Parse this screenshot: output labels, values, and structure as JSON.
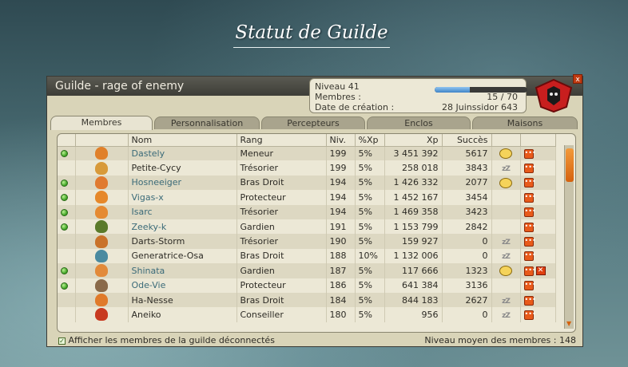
{
  "page_title": "Statut de Guilde",
  "window": {
    "title": "Guilde - rage of enemy",
    "close_label": "x",
    "info": {
      "level_label": "Niveau 41",
      "members_label": "Membres :",
      "members_value": "15 / 70",
      "creation_label": "Date de création :",
      "creation_value": "28 Juinssidor 643",
      "xp_progress": 0.38
    },
    "tabs": [
      "Membres",
      "Personnalisation",
      "Percepteurs",
      "Enclos",
      "Maisons"
    ],
    "active_tab": 0,
    "columns": [
      "Nom",
      "Rang",
      "Niv.",
      "%Xp",
      "Xp",
      "Succès"
    ],
    "members": [
      {
        "online": true,
        "name": "Dastely",
        "rank": "Meneur",
        "level": "199",
        "xp_pct": "5%",
        "xp": "3 451 392",
        "success": "5617",
        "status_icon": "emote"
      },
      {
        "online": false,
        "name": "Petite-Cycy",
        "rank": "Trésorier",
        "level": "199",
        "xp_pct": "5%",
        "xp": "258 018",
        "success": "3843",
        "status_icon": "sleep"
      },
      {
        "online": true,
        "name": "Hosneeiger",
        "rank": "Bras Droit",
        "level": "194",
        "xp_pct": "5%",
        "xp": "1 426 332",
        "success": "2077",
        "status_icon": "emote"
      },
      {
        "online": true,
        "name": "Vigas-x",
        "rank": "Protecteur",
        "level": "194",
        "xp_pct": "5%",
        "xp": "1 452 167",
        "success": "3454",
        "status_icon": ""
      },
      {
        "online": true,
        "name": "Isarc",
        "rank": "Trésorier",
        "level": "194",
        "xp_pct": "5%",
        "xp": "1 469 358",
        "success": "3423",
        "status_icon": ""
      },
      {
        "online": true,
        "name": "Zeeky-k",
        "rank": "Gardien",
        "level": "191",
        "xp_pct": "5%",
        "xp": "1 153 799",
        "success": "2842",
        "status_icon": ""
      },
      {
        "online": false,
        "name": "Darts-Storm",
        "rank": "Trésorier",
        "level": "190",
        "xp_pct": "5%",
        "xp": "159 927",
        "success": "0",
        "status_icon": "sleep"
      },
      {
        "online": false,
        "name": "Generatrice-Osa",
        "rank": "Bras Droit",
        "level": "188",
        "xp_pct": "10%",
        "xp": "1 132 006",
        "success": "0",
        "status_icon": "sleep"
      },
      {
        "online": true,
        "name": "Shinata",
        "rank": "Gardien",
        "level": "187",
        "xp_pct": "5%",
        "xp": "117 666",
        "success": "1323",
        "status_icon": "emote"
      },
      {
        "online": true,
        "name": "Ode-Vie",
        "rank": "Protecteur",
        "level": "186",
        "xp_pct": "5%",
        "xp": "641 384",
        "success": "3136",
        "status_icon": ""
      },
      {
        "online": false,
        "name": "Ha-Nesse",
        "rank": "Bras Droit",
        "level": "184",
        "xp_pct": "5%",
        "xp": "844 183",
        "success": "2627",
        "status_icon": "sleep"
      },
      {
        "online": false,
        "name": "Aneiko",
        "rank": "Conseiller",
        "level": "180",
        "xp_pct": "5%",
        "xp": "956",
        "success": "0",
        "status_icon": "sleep"
      }
    ],
    "action_menu_label": "•••",
    "kick_label": "✕",
    "sleep_label": "zZ",
    "footer_checkbox_label": "Afficher les membres de la guilde déconnectés",
    "footer_average": "Niveau moyen des membres : 148"
  },
  "colors": {
    "accent_orange": "#e85a1a",
    "online_green": "#3aa020",
    "emblem_red": "#c81e1e"
  }
}
